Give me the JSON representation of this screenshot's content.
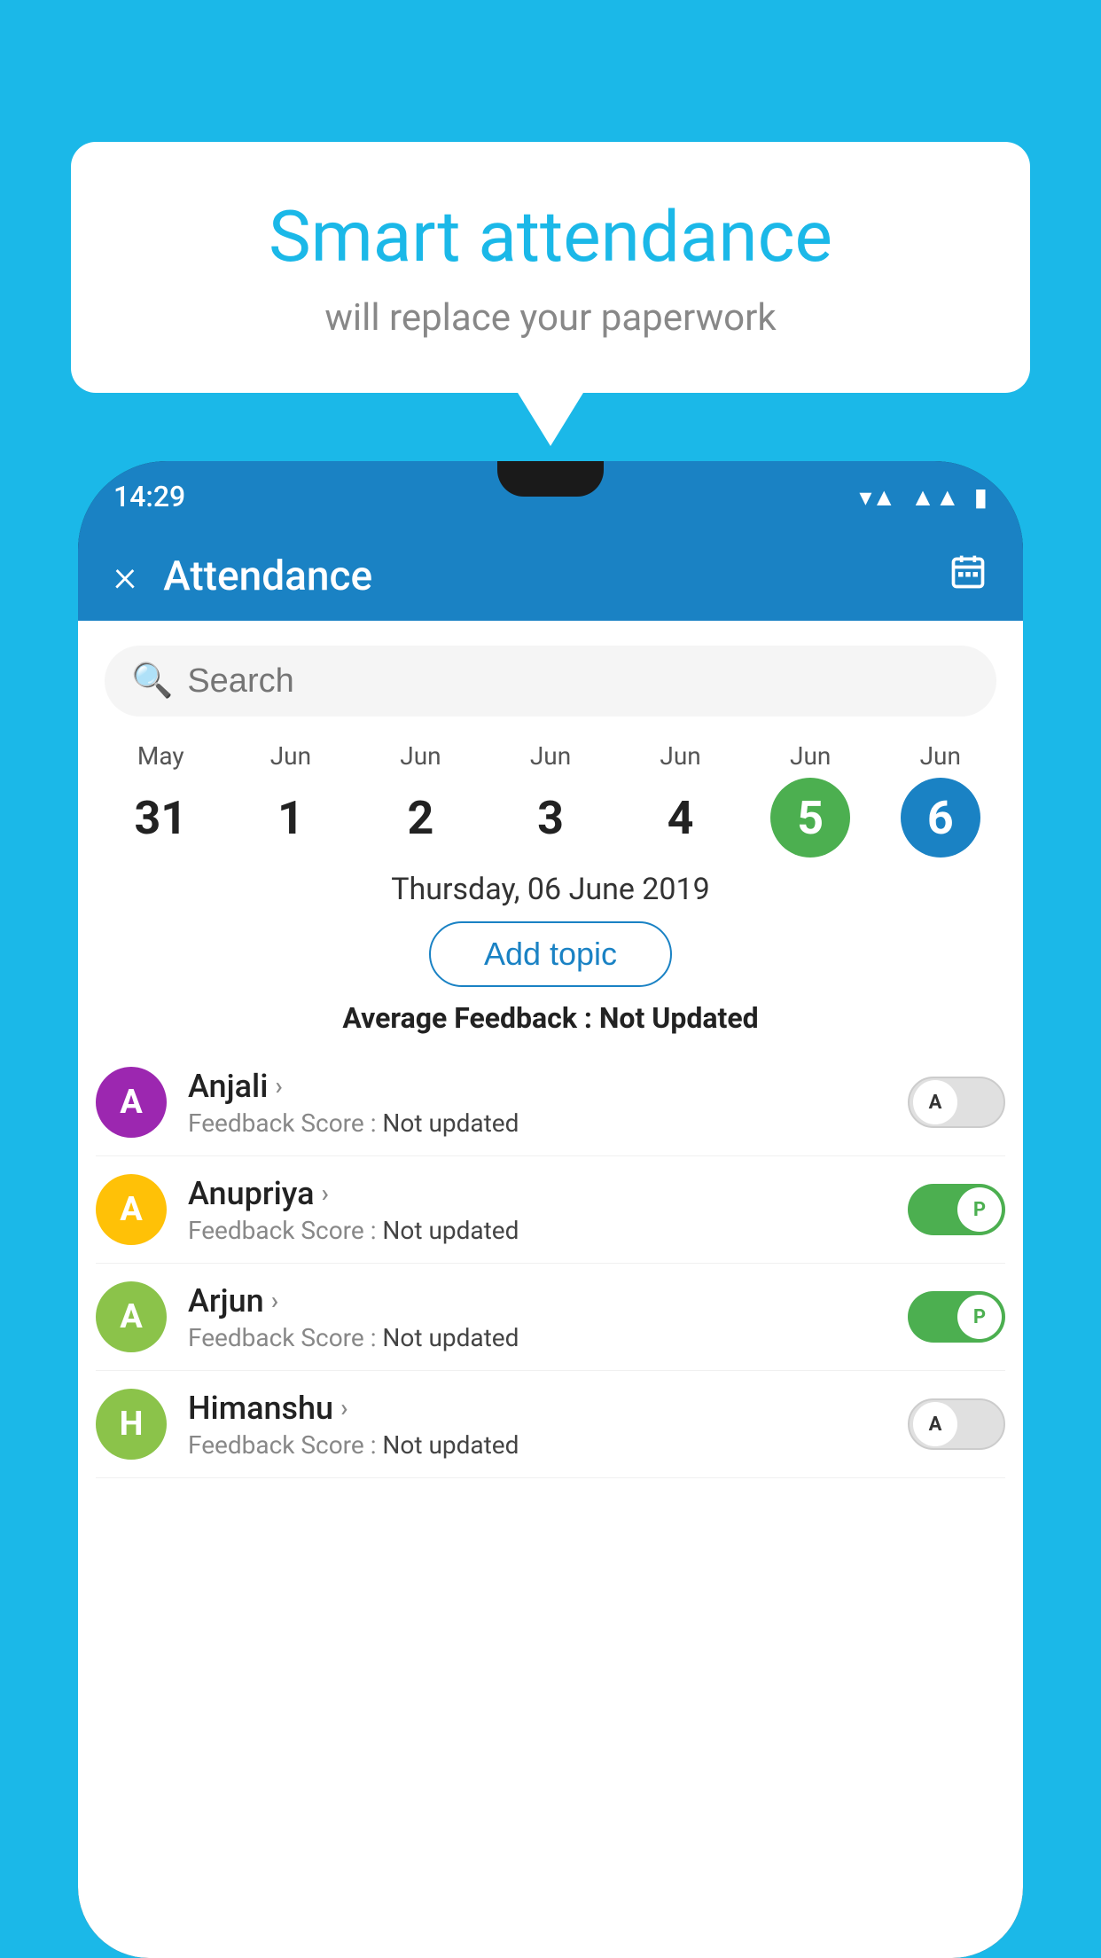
{
  "background_color": "#1BB8E8",
  "speech_bubble": {
    "title": "Smart attendance",
    "subtitle": "will replace your paperwork"
  },
  "status_bar": {
    "time": "14:29",
    "icons": [
      "wifi",
      "signal",
      "battery"
    ]
  },
  "app_bar": {
    "title": "Attendance",
    "close_icon": "×",
    "calendar_icon": "calendar"
  },
  "search": {
    "placeholder": "Search"
  },
  "calendar": {
    "days": [
      {
        "month": "May",
        "date": "31",
        "state": "normal"
      },
      {
        "month": "Jun",
        "date": "1",
        "state": "normal"
      },
      {
        "month": "Jun",
        "date": "2",
        "state": "normal"
      },
      {
        "month": "Jun",
        "date": "3",
        "state": "normal"
      },
      {
        "month": "Jun",
        "date": "4",
        "state": "normal"
      },
      {
        "month": "Jun",
        "date": "5",
        "state": "today"
      },
      {
        "month": "Jun",
        "date": "6",
        "state": "selected"
      }
    ]
  },
  "selected_date_label": "Thursday, 06 June 2019",
  "add_topic_label": "Add topic",
  "avg_feedback": {
    "label": "Average Feedback : ",
    "value": "Not Updated"
  },
  "students": [
    {
      "name": "Anjali",
      "avatar_letter": "A",
      "avatar_color": "#9C27B0",
      "feedback_label": "Feedback Score : ",
      "feedback_value": "Not updated",
      "toggle_state": "off",
      "toggle_label": "A"
    },
    {
      "name": "Anupriya",
      "avatar_letter": "A",
      "avatar_color": "#FFC107",
      "feedback_label": "Feedback Score : ",
      "feedback_value": "Not updated",
      "toggle_state": "on",
      "toggle_label": "P"
    },
    {
      "name": "Arjun",
      "avatar_letter": "A",
      "avatar_color": "#8BC34A",
      "feedback_label": "Feedback Score : ",
      "feedback_value": "Not updated",
      "toggle_state": "on",
      "toggle_label": "P"
    },
    {
      "name": "Himanshu",
      "avatar_letter": "H",
      "avatar_color": "#8BC34A",
      "feedback_label": "Feedback Score : ",
      "feedback_value": "Not updated",
      "toggle_state": "off",
      "toggle_label": "A"
    }
  ]
}
